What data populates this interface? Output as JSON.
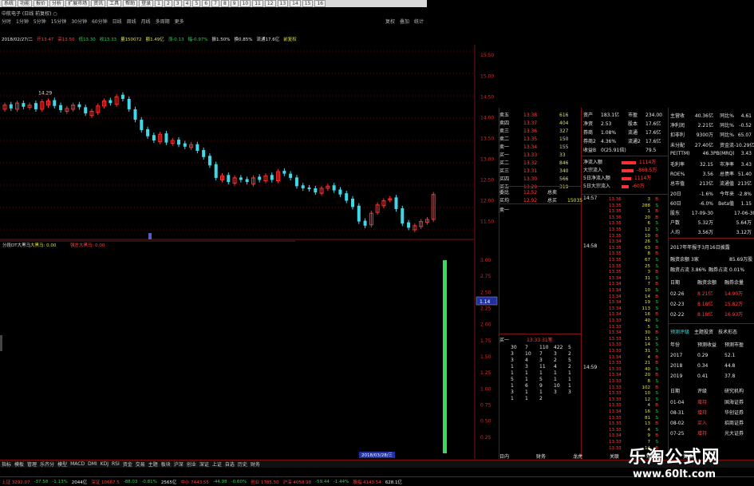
{
  "title_line": "中航电子 (日线 前复权) ○",
  "toolbar": {
    "buttons": [
      "系统",
      "功能",
      "报价",
      "分析",
      "扩展市场",
      "资讯",
      "工具",
      "帮助",
      "登录",
      "1",
      "2",
      "3",
      "4",
      "5",
      "6",
      "7",
      "8",
      "9",
      "10",
      "11",
      "12",
      "13",
      "14",
      "15",
      "16"
    ]
  },
  "period_bar": {
    "items": [
      "分时",
      "1分钟",
      "5分钟",
      "15分钟",
      "30分钟",
      "60分钟",
      "日线",
      "周线",
      "月线",
      "多周期",
      "更多"
    ],
    "right": [
      "复权",
      "叠加",
      "统计"
    ]
  },
  "info_line": [
    {
      "text": "2018/02/27/二",
      "color": "white"
    },
    {
      "text": "开13.47",
      "color": "red"
    },
    {
      "text": "高13.50",
      "color": "red"
    },
    {
      "text": "低13.30",
      "color": "green"
    },
    {
      "text": "收13.33",
      "color": "green"
    },
    {
      "text": "量150072",
      "color": "yellow"
    },
    {
      "text": "额1.49亿",
      "color": "yellow"
    },
    {
      "text": "涨-0.13",
      "color": "green"
    },
    {
      "text": "幅-0.97%",
      "color": "green"
    },
    {
      "text": "振1.50%",
      "color": "white"
    },
    {
      "text": "换0.85%",
      "color": "white"
    },
    {
      "text": "流通17.6亿",
      "color": "white"
    },
    {
      "text": "前复权",
      "color": "yellow"
    }
  ],
  "price_axis": [
    "15.50",
    "15.00",
    "14.50",
    "14.00",
    "13.50",
    "13.00",
    "12.50",
    "12.00",
    "11.50"
  ],
  "price_high_label": "14.29",
  "lower_indicator": {
    "name": "分段DT大黑马",
    "label1": "大黑马: 0.00",
    "label2": "强庄大黑马: 0.00"
  },
  "lower_axis": [
    "3.00",
    "2.75",
    "2.50",
    "2.25",
    "2.00",
    "1.75",
    "1.50",
    "1.25",
    "1.00",
    "0.75",
    "0.50",
    "0.25"
  ],
  "cursor_value": "1.14",
  "cursor_date": "2018/03/28/三",
  "chart_data": {
    "type": "candlestick",
    "closes": [
      14.3,
      14.22,
      14.35,
      14.26,
      14.3,
      14.2,
      14.38,
      14.4,
      14.28,
      14.18,
      14.22,
      14.3,
      14.25,
      14.1,
      14.15,
      14.28,
      14.4,
      14.35,
      14.5,
      14.45,
      14.2,
      13.95,
      13.7,
      13.55,
      13.45,
      13.6,
      13.4,
      13.45,
      13.35,
      13.3,
      13.35,
      13.2,
      13.05,
      12.85,
      12.55,
      12.6,
      12.45,
      12.55,
      12.5,
      12.45,
      12.55,
      12.5,
      12.6,
      12.5,
      12.7,
      12.65,
      12.55,
      12.35,
      12.3,
      12.28,
      12.2,
      12.3,
      12.35,
      12.25,
      12.15,
      12.0,
      11.85,
      11.5,
      11.4,
      11.7,
      11.9,
      12.0,
      12.05,
      11.8,
      11.45,
      11.35,
      11.4,
      11.5,
      11.55,
      12.15
    ],
    "opens": [
      14.2,
      14.32,
      14.2,
      14.35,
      14.25,
      14.35,
      14.2,
      14.3,
      14.42,
      14.3,
      14.15,
      14.2,
      14.32,
      14.25,
      14.05,
      14.12,
      14.28,
      14.42,
      14.32,
      14.55,
      14.45,
      14.2,
      13.95,
      13.72,
      13.58,
      13.42,
      13.62,
      13.38,
      13.47,
      13.38,
      13.28,
      13.36,
      13.22,
      13.08,
      12.88,
      12.5,
      12.62,
      12.42,
      12.56,
      12.52,
      12.4,
      12.58,
      12.48,
      12.62,
      12.48,
      12.72,
      12.65,
      12.56,
      12.37,
      12.32,
      12.3,
      12.18,
      12.3,
      12.37,
      12.27,
      12.18,
      12.05,
      11.88,
      11.52,
      11.42,
      11.72,
      11.88,
      12.02,
      12.08,
      11.82,
      11.48,
      11.3,
      11.38,
      11.48,
      11.55
    ],
    "volume_last": 3.0
  },
  "quote_panel": {
    "asks": [
      {
        "label": "卖五",
        "price": "13.38",
        "vol": "616"
      },
      {
        "label": "卖四",
        "price": "13.37",
        "vol": "404"
      },
      {
        "label": "卖三",
        "price": "13.36",
        "vol": "327"
      },
      {
        "label": "卖二",
        "price": "13.35",
        "vol": "150"
      },
      {
        "label": "卖一",
        "price": "13.34",
        "vol": "155"
      }
    ],
    "bids": [
      {
        "label": "买一",
        "price": "13.33",
        "vol": "33"
      },
      {
        "label": "买二",
        "price": "13.32",
        "vol": "846"
      },
      {
        "label": "买三",
        "price": "13.31",
        "vol": "340"
      },
      {
        "label": "买四",
        "price": "13.30",
        "vol": "566"
      },
      {
        "label": "买五",
        "price": "13.29",
        "vol": "319"
      }
    ],
    "summary": [
      {
        "a": "委比",
        "b": "12.52",
        "c": "总卖"
      },
      {
        "a": "买均",
        "b": "12.92",
        "c": "总买",
        "d": "15035"
      }
    ],
    "sell1_label": "卖一",
    "buy1_label": "买一",
    "buy1_row": "13.33  31笔",
    "tick_queue": [
      [
        "30",
        "7",
        "110",
        "422",
        "5"
      ],
      [
        "3",
        "10",
        "7",
        "3",
        "2"
      ],
      [
        "3",
        "4",
        "3",
        "2",
        "5"
      ],
      [
        "1",
        "3",
        "11",
        "4",
        "2"
      ],
      [
        "1",
        "1",
        "1",
        "1",
        "1"
      ],
      [
        "5",
        "1",
        "5",
        "1",
        "1"
      ],
      [
        "1",
        "6",
        "9",
        "10",
        "1"
      ],
      [
        "3",
        "1",
        "1",
        "3",
        "3"
      ],
      [
        "1",
        "1",
        "2"
      ]
    ]
  },
  "fund_panel": {
    "rows": [
      {
        "k": "资产",
        "v1": "183.1亿",
        "k2": "市盈",
        "v2": "234.00"
      },
      {
        "k": "净资",
        "v1": "2.53",
        "k2": "股本",
        "v2": "17.6亿"
      },
      {
        "k": "券商",
        "v1": "1.08%",
        "k2": "流通",
        "v2": "17.6亿"
      },
      {
        "k": "券商2",
        "v1": "4.36%",
        "k2": "流通2",
        "v2": "17.6亿"
      },
      {
        "k": "收益B",
        "v1": "0(25.91倍)",
        "k2": "",
        "v2": "79.5"
      }
    ],
    "flow": [
      {
        "k": "净流入额",
        "v": "1114万"
      },
      {
        "k": "大宗流入",
        "v": "-869.5万"
      },
      {
        "k": "5日净流入额",
        "v": "1114万"
      },
      {
        "k": "5日大宗流入",
        "v": "-60万"
      }
    ],
    "time1": "14:57",
    "time2": "14:58",
    "time3": "14:59"
  },
  "trade_ticks": [
    [
      "13.36",
      "3",
      "B"
    ],
    [
      "13.35",
      "288",
      "S"
    ],
    [
      "13.35",
      "1",
      "B"
    ],
    [
      "13.36",
      "20",
      "B"
    ],
    [
      "13.35",
      "6",
      "S"
    ],
    [
      "13.35",
      "12",
      "S"
    ],
    [
      "13.35",
      "10",
      "B"
    ],
    [
      "13.34",
      "26",
      "S"
    ],
    [
      "13.35",
      "63",
      "B"
    ],
    [
      "13.35",
      "8",
      "B"
    ],
    [
      "13.35",
      "67",
      "S"
    ],
    [
      "13.35",
      "25",
      "S"
    ],
    [
      "13.35",
      "3",
      "B"
    ],
    [
      "13.34",
      "31",
      "S"
    ],
    [
      "13.34",
      "7",
      "B"
    ],
    [
      "13.34",
      "10",
      "S"
    ],
    [
      "13.34",
      "14",
      "B"
    ],
    [
      "13.34",
      "19",
      "S"
    ],
    [
      "13.34",
      "113",
      "S"
    ],
    [
      "13.34",
      "16",
      "B"
    ],
    [
      "13.33",
      "40",
      "S"
    ],
    [
      "13.33",
      "5",
      "S"
    ],
    [
      "13.34",
      "30",
      "B"
    ],
    [
      "13.33",
      "15",
      "S"
    ],
    [
      "13.33",
      "14",
      "S"
    ],
    [
      "13.33",
      "31",
      "S"
    ],
    [
      "13.34",
      "4",
      "B"
    ],
    [
      "13.33",
      "21",
      "B"
    ],
    [
      "13.33",
      "40",
      "S"
    ],
    [
      "13.34",
      "20",
      "B"
    ],
    [
      "13.33",
      "8",
      "S"
    ],
    [
      "13.33",
      "102",
      "B"
    ],
    [
      "13.33",
      "10",
      "S"
    ],
    [
      "13.33",
      "12",
      "S"
    ],
    [
      "13.33",
      "4",
      "B"
    ],
    [
      "13.34",
      "16",
      "S"
    ],
    [
      "13.33",
      "81",
      "S"
    ],
    [
      "13.33",
      "13",
      "B"
    ],
    [
      "13.33",
      "4",
      "S"
    ],
    [
      "13.34",
      "9",
      "B"
    ],
    [
      "13.33",
      "7",
      "S"
    ],
    [
      "13.33",
      "14",
      "B"
    ]
  ],
  "finance": {
    "rows": [
      {
        "k": "主营收",
        "v": "40.36亿",
        "k2": "同比%",
        "v2": "4.61"
      },
      {
        "k": "净利润",
        "v": "2.21亿",
        "k2": "同比%",
        "v2": "-0.52"
      },
      {
        "k": "扣非利",
        "v": "9300万",
        "k2": "同比%",
        "v2": "65.07"
      },
      {
        "k": "未分配",
        "v": "27.40亿",
        "k2": "资金流",
        "v2": "-10.29亿"
      },
      {
        "k": "PE(TTM)",
        "v": "46.3",
        "k2": "PB(MRQ)",
        "v2": "3.43"
      },
      {
        "k": "毛利率",
        "v": "32.15",
        "k2": "市净率",
        "v2": "3.43"
      },
      {
        "k": "ROE%",
        "v": "3.56",
        "k2": "总债率",
        "v2": "51.40"
      },
      {
        "k": "总市值",
        "v": "213亿",
        "k2": "流通值",
        "v2": "213亿"
      },
      {
        "k": "20日",
        "v": "-1.6%",
        "k2": "今年来",
        "v2": "-2.8%"
      },
      {
        "k": "60日",
        "v": "-6.0%",
        "k2": "Beta值",
        "v2": "1.15"
      },
      {
        "k": "股东",
        "v": "17-09-30",
        "k2": "",
        "v2": "17-06-30"
      },
      {
        "k": "户数",
        "v": "5.32万",
        "k2": "",
        "v2": "5.64万"
      },
      {
        "k": "人均",
        "v": "3.56万",
        "k2": "",
        "v2": "3.12万"
      }
    ],
    "report_line": "2017年年报于3月16日披露",
    "margin_rows": [
      {
        "k": "融资余额",
        "v": "3家",
        "k2": "",
        "v2": "85.69万股"
      },
      {
        "k": "融资占流",
        "v": "3.86%",
        "k2": "融券占流",
        "v2": "0.01%"
      }
    ],
    "margin_header": [
      "日期",
      "融资余额",
      "融券余量"
    ],
    "margin_data": [
      [
        "02-26",
        "8.21亿",
        "14.90万"
      ],
      [
        "02-23",
        "8.18亿",
        "15.82万"
      ],
      [
        "02-22",
        "8.18亿",
        "16.93万"
      ]
    ],
    "forecast_tabs": [
      "预测评级",
      "主题投资",
      "技术形态"
    ],
    "forecast_header": [
      "年份",
      "预测收益",
      "预测市盈"
    ],
    "forecast_data": [
      [
        "2017",
        "0.29",
        "52.1"
      ],
      [
        "2018",
        "0.34",
        "44.8"
      ],
      [
        "2019",
        "0.41",
        "37.8"
      ]
    ],
    "rating_header": [
      "日期",
      "评级",
      "研究机构"
    ],
    "rating_data": [
      [
        "01-04",
        "增持",
        "国海证券"
      ],
      [
        "08-31",
        "增持",
        "华创证券"
      ],
      [
        "08-02",
        "买入",
        "招商证券"
      ],
      [
        "07-25",
        "增持",
        "光大证券"
      ]
    ]
  },
  "bottom_tabs": [
    "指标",
    "模板",
    "管理",
    "乐齐分",
    "模型",
    "MACD",
    "DMI",
    "KDJ",
    "RSI",
    "资金",
    "交易",
    "主题",
    "板块",
    "沪深",
    "创业",
    "深证",
    "上证",
    "自选",
    "历史",
    "财务"
  ],
  "right_tabs": [
    "日内",
    "财务",
    "龙虎",
    "关联",
    "短线",
    "资讯"
  ],
  "status_items": [
    {
      "text": "上证 3292.07",
      "color": "red"
    },
    {
      "text": "-37.58",
      "color": "green"
    },
    {
      "text": "-1.13%",
      "color": "green"
    },
    {
      "text": "2044亿",
      "color": "white"
    },
    {
      "text": "深证 10667.5",
      "color": "red"
    },
    {
      "text": "-88.03",
      "color": "green"
    },
    {
      "text": "-0.81%",
      "color": "green"
    },
    {
      "text": "2565亿",
      "color": "white"
    },
    {
      "text": "中小 7443.55",
      "color": "red"
    },
    {
      "text": "-44.98",
      "color": "green"
    },
    {
      "text": "-0.60%",
      "color": "green"
    },
    {
      "text": "创业 1785.50",
      "color": "red"
    },
    {
      "text": "沪深 4058.98",
      "color": "red"
    },
    {
      "text": "-59.44",
      "color": "green"
    },
    {
      "text": "-1.44%",
      "color": "green"
    },
    {
      "text": "股指 4143.54",
      "color": "red"
    },
    {
      "text": "628.1亿",
      "color": "white"
    }
  ],
  "watermark": {
    "line1": "乐淘公式网",
    "line2": "www.60lt.com"
  },
  "colors": {
    "up": "#ff3030",
    "down": "#40d8e8",
    "volume": "#39d95a",
    "grid": "#7a1010"
  }
}
